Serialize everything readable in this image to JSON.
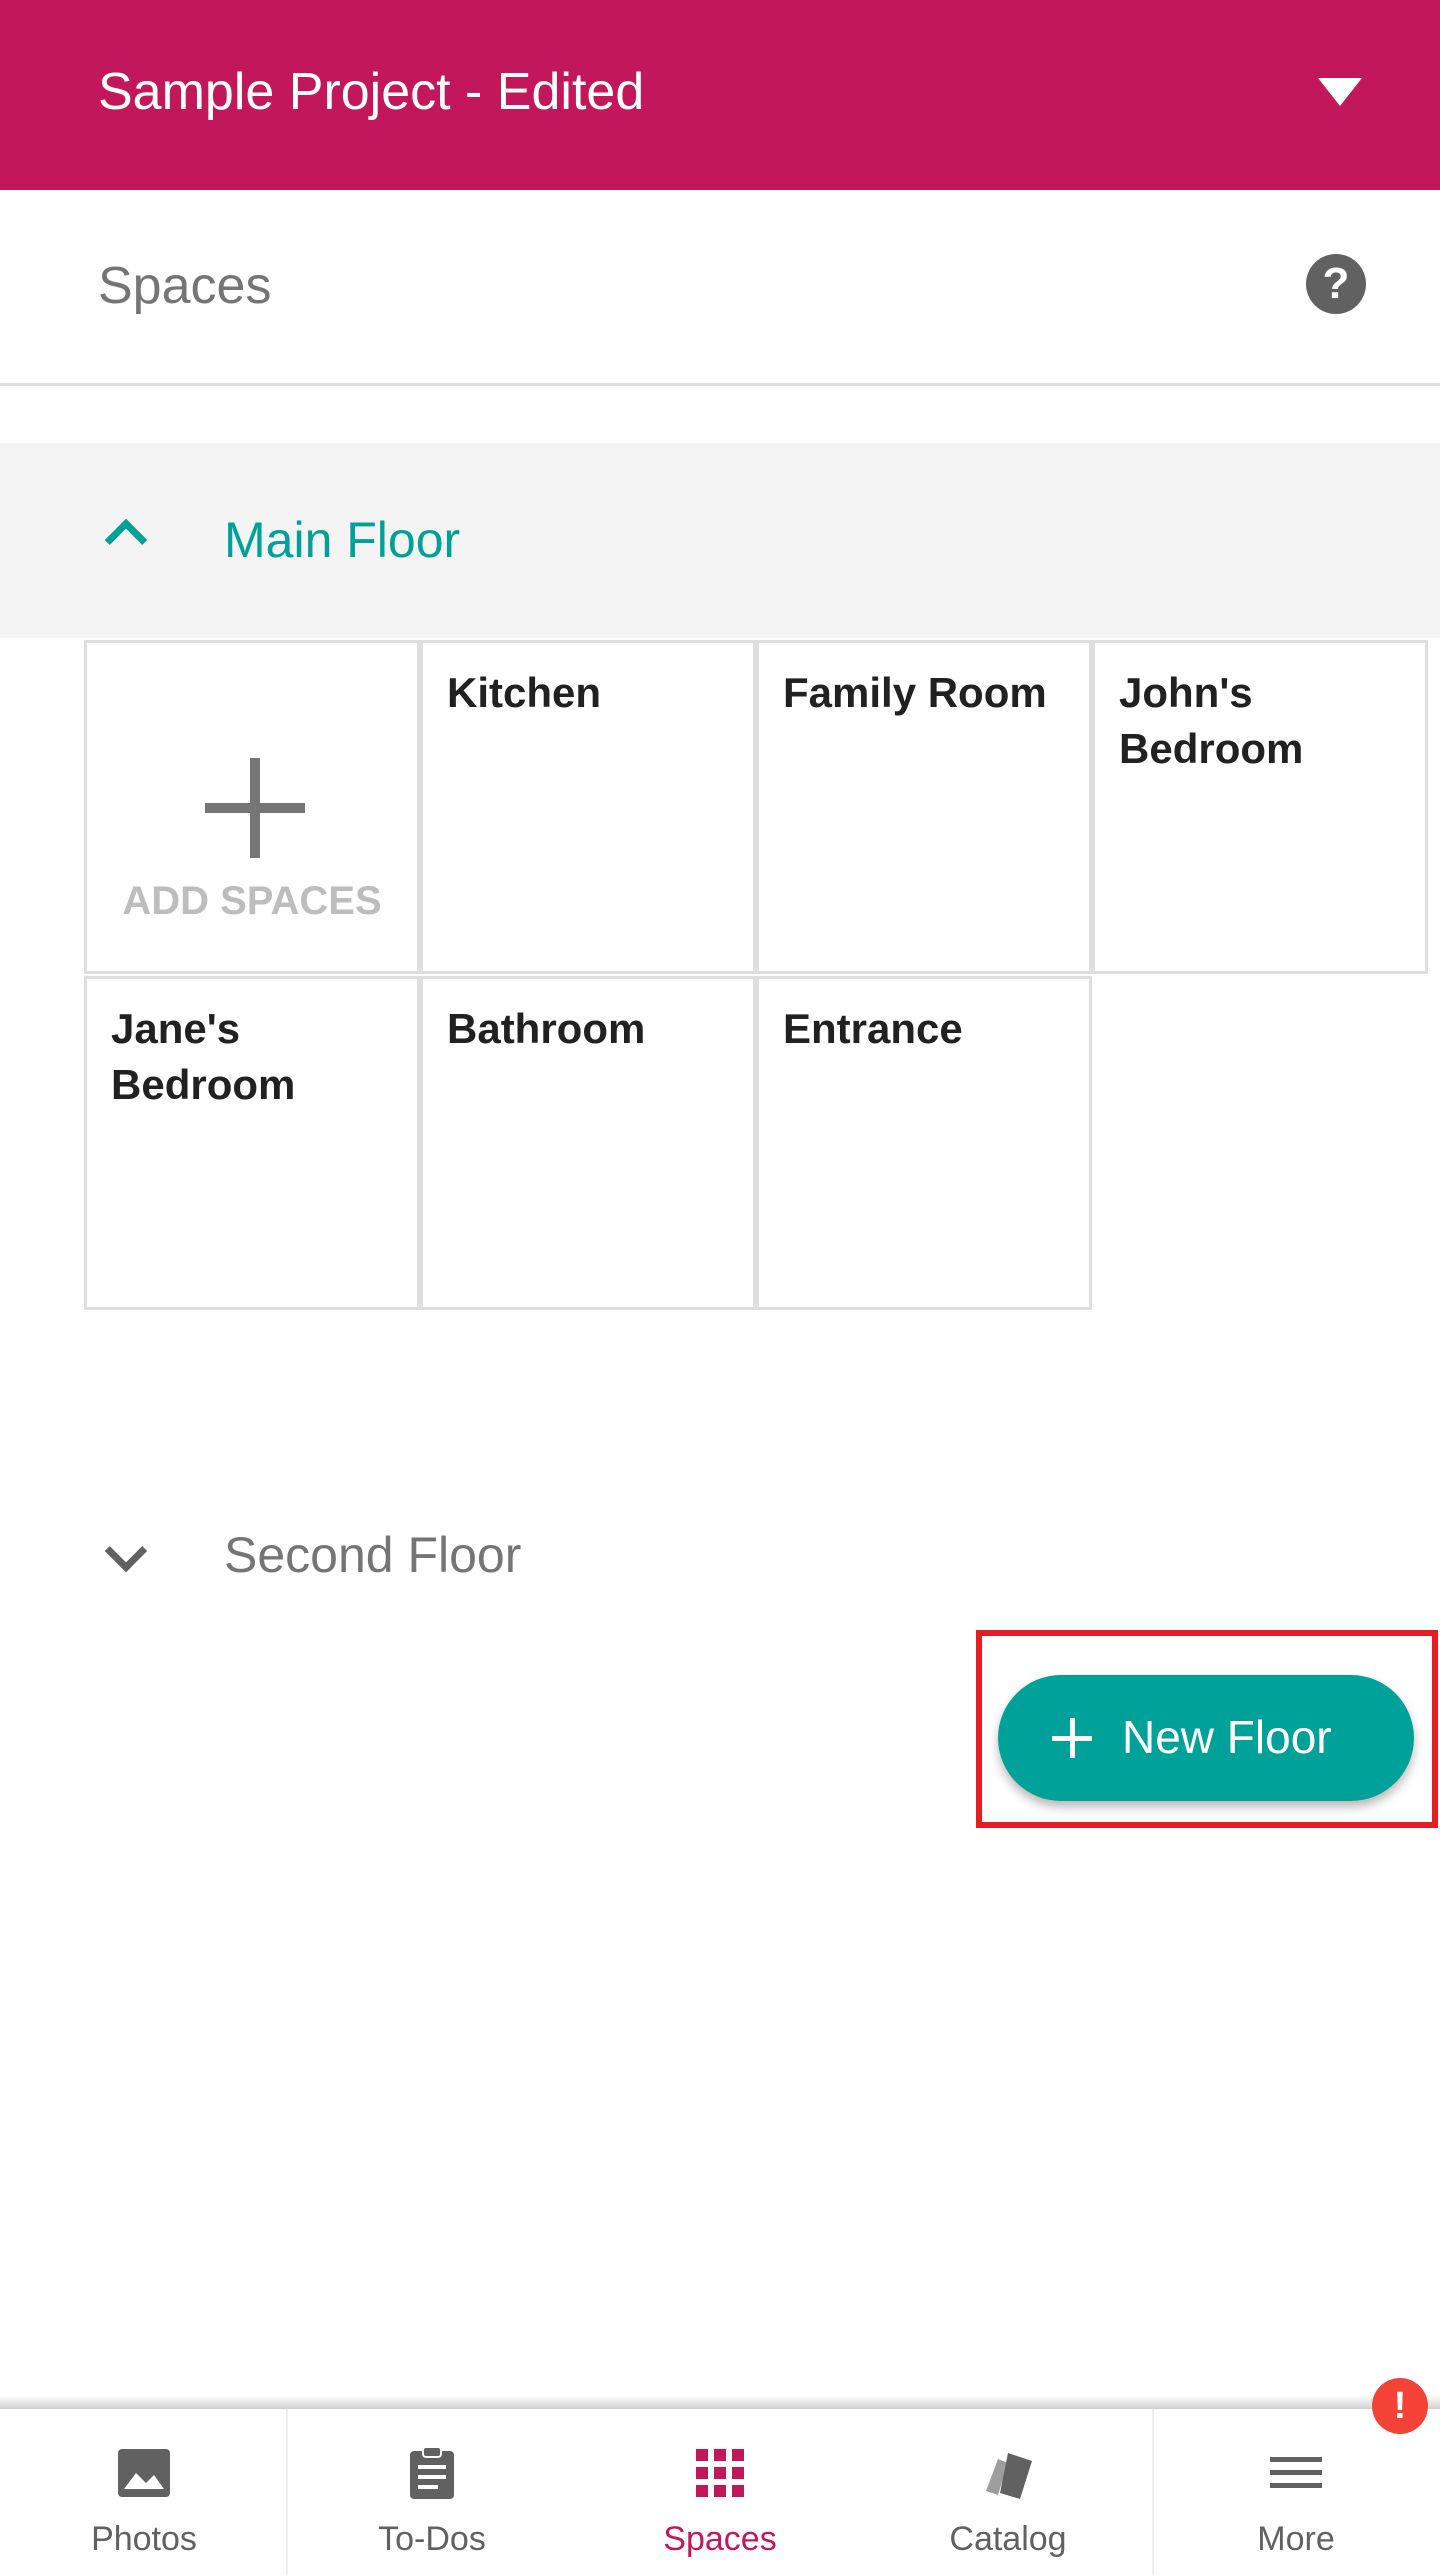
{
  "header": {
    "title": "Sample Project - Edited",
    "caret_icon": "dropdown-caret-icon"
  },
  "subheader": {
    "title": "Spaces",
    "help_icon": "help-icon",
    "help_glyph": "?"
  },
  "floors": [
    {
      "label": "Main Floor",
      "expanded": true,
      "add_label": "ADD SPACES",
      "spaces": [
        "Kitchen",
        "Family Room",
        "John's Bedroom",
        "Jane's Bedroom",
        "Bathroom",
        "Entrance"
      ]
    },
    {
      "label": "Second Floor",
      "expanded": false
    }
  ],
  "fab": {
    "label": "New Floor",
    "icon": "plus-icon"
  },
  "bottom_nav": {
    "items": [
      {
        "label": "Photos",
        "icon": "photo-icon",
        "active": false
      },
      {
        "label": "To-Dos",
        "icon": "clipboard-icon",
        "active": false
      },
      {
        "label": "Spaces",
        "icon": "grid-icon",
        "active": true
      },
      {
        "label": "Catalog",
        "icon": "swatch-icon",
        "active": false
      },
      {
        "label": "More",
        "icon": "menu-icon",
        "active": false
      }
    ],
    "alert_badge": "!"
  },
  "colors": {
    "brand": "#c2185b",
    "accent": "#00a198",
    "highlight": "#e31e24",
    "badge": "#f44336"
  }
}
